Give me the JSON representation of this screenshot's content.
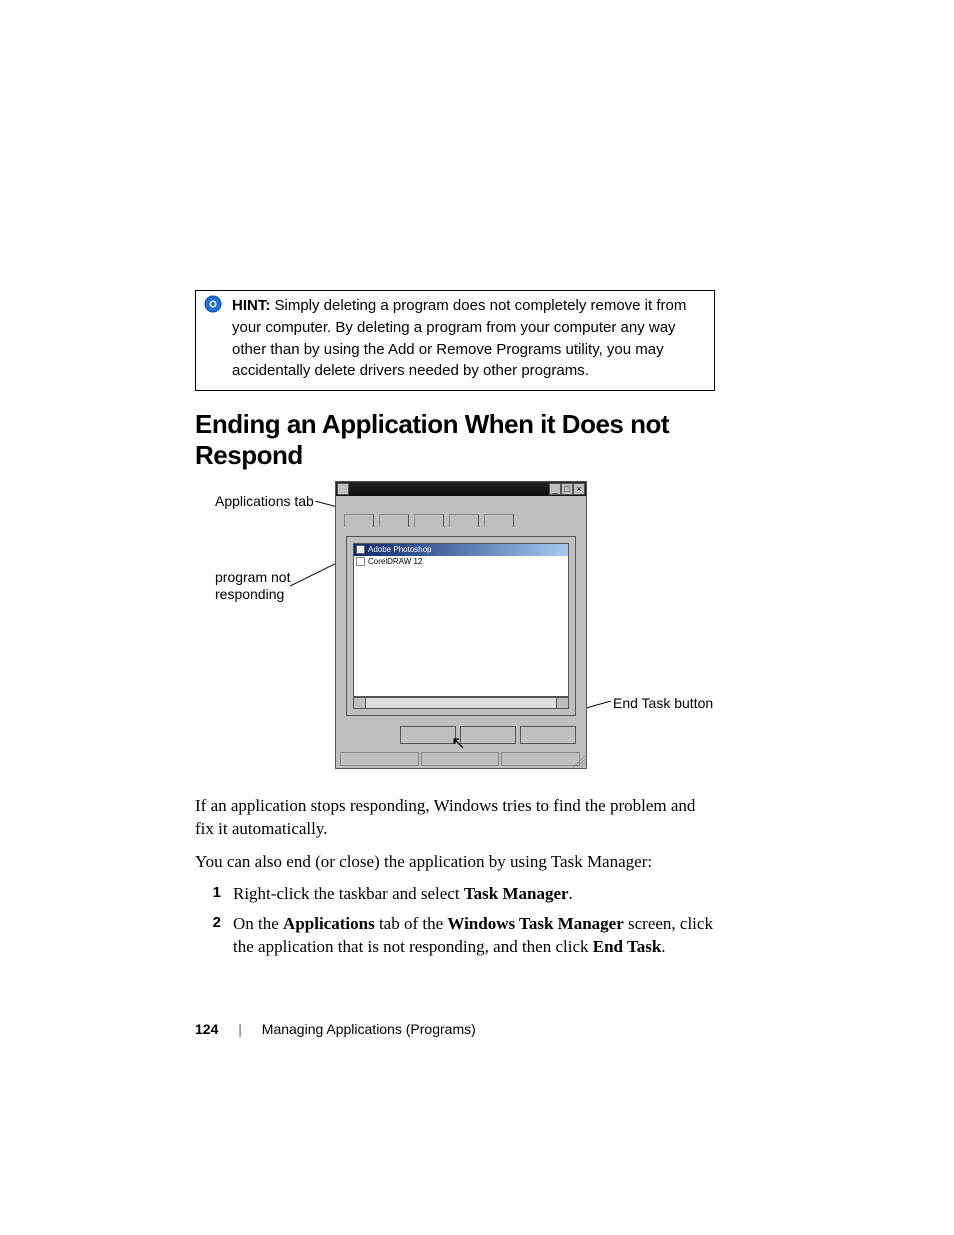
{
  "hint": {
    "label": "HINT:",
    "text": "Simply deleting a program does not completely remove it from your computer. By deleting a program from your computer any way other than by using the Add or Remove Programs utility, you may accidentally delete drivers needed by other programs."
  },
  "heading": "Ending an Application When it Does not Respond",
  "callouts": {
    "applications_tab": "Applications tab",
    "program_not_responding": "program not responding",
    "end_task_button": "End Task button"
  },
  "task_manager": {
    "rows": [
      {
        "label": "Adobe Photoshop",
        "selected": true
      },
      {
        "label": "CorelDRAW 12",
        "selected": false
      }
    ]
  },
  "para1": "If an application stops responding, Windows tries to find the problem and fix it automatically.",
  "para2": "You can also end (or close) the application by using Task Manager:",
  "steps": [
    {
      "num": "1",
      "pre": "Right-click the taskbar and select ",
      "bold1": "Task Manager",
      "post": ".",
      "mid": "",
      "bold2": "",
      "mid2": "",
      "bold3": "",
      "tail": ""
    },
    {
      "num": "2",
      "pre": "On the ",
      "bold1": "Applications",
      "mid": " tab of the ",
      "bold2": "Windows Task Manager",
      "mid2": " screen, click the application that is not responding, and then click ",
      "bold3": "End Task",
      "tail": "."
    }
  ],
  "footer": {
    "page_number": "124",
    "chapter": "Managing Applications (Programs)"
  }
}
